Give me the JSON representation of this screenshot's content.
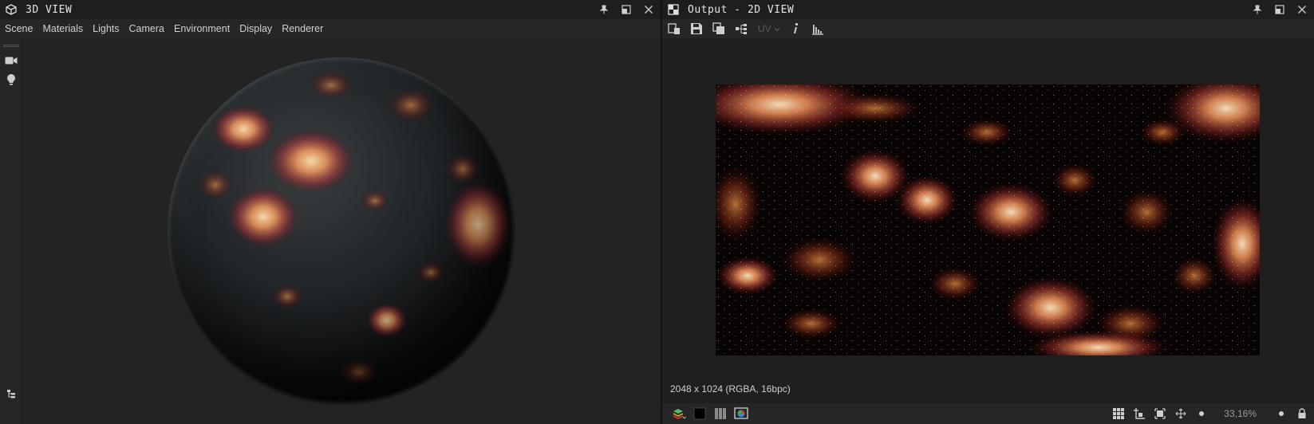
{
  "left_panel": {
    "title": "3D VIEW",
    "menu": [
      "Scene",
      "Materials",
      "Lights",
      "Camera",
      "Environment",
      "Display",
      "Renderer"
    ],
    "side_tools": [
      "camera-icon",
      "light-bulb-icon"
    ],
    "corner_tool": "scene-tree-icon"
  },
  "right_panel": {
    "title": "Output - 2D VIEW",
    "toolbar": {
      "buttons": [
        "export-icon",
        "save-icon",
        "copy-icon",
        "graph-link-icon"
      ],
      "uv_label": "UV",
      "info_icon": "info-icon",
      "histogram_icon": "histogram-icon"
    },
    "image_info": "2048 x 1024 (RGBA, 16bpc)",
    "status": {
      "zoom": "33,16%",
      "left_tools": [
        "layers-icon",
        "black-swatch-icon",
        "tiling-icon",
        "color-mode-icon"
      ],
      "right_tools": [
        "grid-icon",
        "pivot-icon",
        "fit-icon",
        "pan-icon",
        "zoom-out-icon",
        "zoom-in-icon",
        "lock-icon"
      ]
    }
  },
  "title_actions": [
    "pin-icon",
    "maximize-icon",
    "close-icon"
  ],
  "colors": {
    "lava_hot": "#f5c08a",
    "lava_mid": "#d4603a",
    "lava_dark": "#6a1a10",
    "rock": "#1a1c1d"
  }
}
